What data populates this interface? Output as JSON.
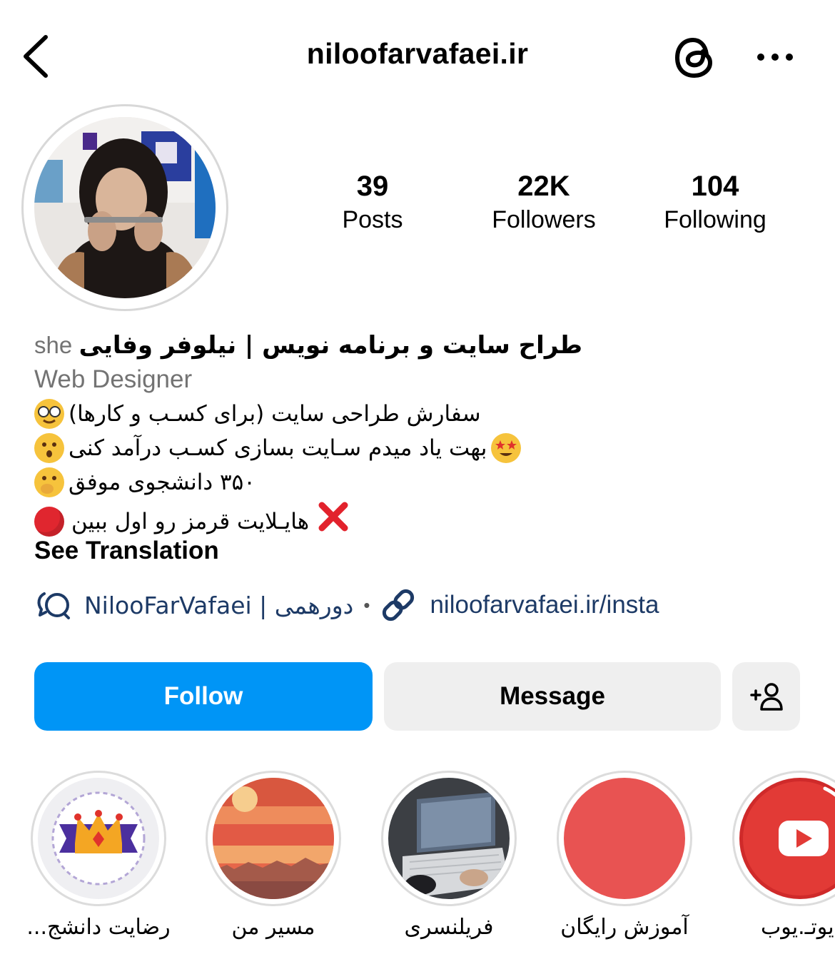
{
  "header": {
    "username": "niloofarvafaei.ir",
    "back_icon": "chevron-left-icon",
    "threads_icon": "threads-icon",
    "more_icon": "more-horizontal-icon"
  },
  "stats": [
    {
      "value": "39",
      "label": "Posts"
    },
    {
      "value": "22K",
      "label": "Followers"
    },
    {
      "value": "104",
      "label": "Following"
    }
  ],
  "bio": {
    "pronoun": "she",
    "name": "طراح سایت و برنامه نویس | نیلوفر وفایی",
    "category": "Web Designer",
    "lines": [
      "سفارش طراحی سایت (برای کسـب و کارها)",
      "بهت یاد میدم سـایت بسازی کسـب درآمد کنی",
      "۳۵۰ دانشجوی موفق",
      "هایـلایت قرمز رو اول ببین"
    ],
    "see_translation": "See Translation"
  },
  "links": {
    "threads_link": "NilooFarVafaei | دورهمی",
    "separator": "•",
    "website": "niloofarvafaei.ir/insta"
  },
  "actions": {
    "follow": "Follow",
    "message": "Message"
  },
  "highlights": [
    {
      "label": "رضایت دانشج..."
    },
    {
      "label": "مسیر من"
    },
    {
      "label": "فریلنسری"
    },
    {
      "label": "آموزش رایگان"
    },
    {
      "label": "یوتـ.یوب"
    }
  ],
  "colors": {
    "follow_blue": "#0095f6",
    "link_navy": "#1d3a66",
    "secondary_gray": "#737373",
    "button_gray": "#efefef"
  }
}
